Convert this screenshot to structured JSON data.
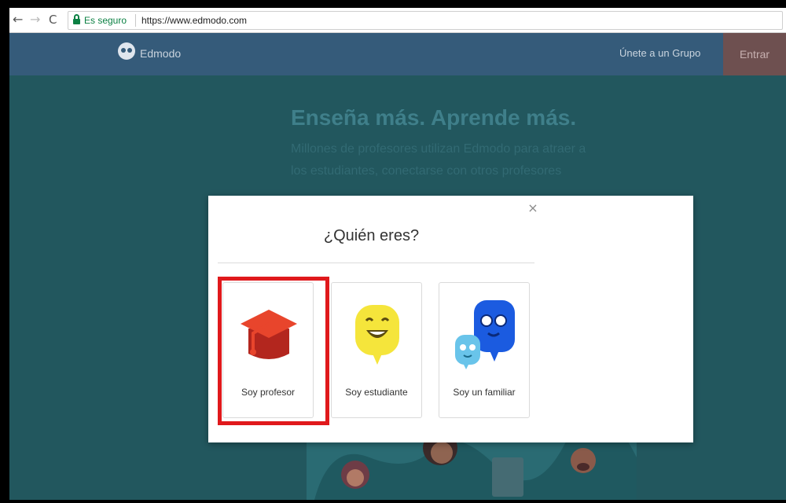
{
  "browser": {
    "secure_label": "Es seguro",
    "url": "https://www.edmodo.com"
  },
  "header": {
    "logo_text": "Edmodo",
    "join_group": "Únete a un Grupo",
    "sign_in": "Entrar"
  },
  "hero": {
    "title": "Enseña más. Aprende más.",
    "subtitle": "Millones de profesores utilizan Edmodo para atraer a los estudiantes, conectarse con otros profesores"
  },
  "modal": {
    "title": "¿Quién eres?",
    "close": "×",
    "options": [
      {
        "label": "Soy profesor",
        "icon": "graduation-cap-icon",
        "color": "#e8452c"
      },
      {
        "label": "Soy estudiante",
        "icon": "student-bubble-icon",
        "color": "#f5e53b"
      },
      {
        "label": "Soy un familiar",
        "icon": "family-bubbles-icon",
        "color": "#1b5be0"
      }
    ]
  },
  "colors": {
    "highlight": "#e0191c",
    "header_bg": "#355b7a",
    "overlay_bg": "#22575e"
  }
}
